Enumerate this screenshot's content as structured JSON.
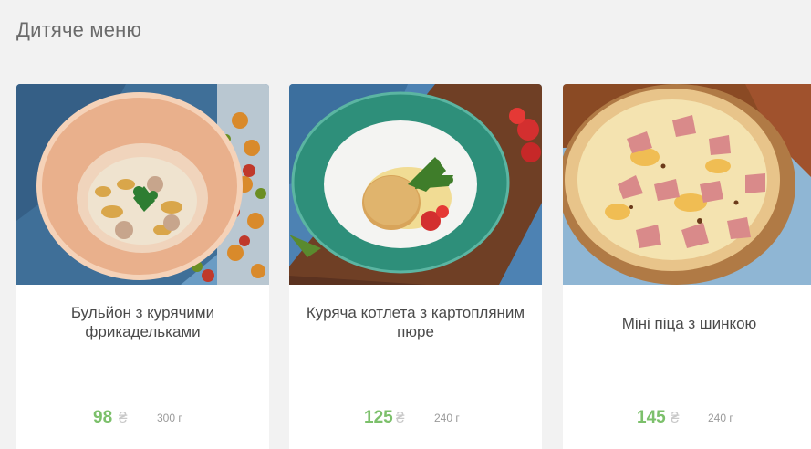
{
  "section": {
    "title": "Дитяче меню"
  },
  "items": [
    {
      "name": "Бульйон з курячими фрикадельками",
      "price": "98",
      "currency": "₴",
      "weight": "300 г"
    },
    {
      "name": "Куряча котлета з картопляним пюре",
      "price": "125",
      "currency": "₴",
      "weight": "240 г"
    },
    {
      "name": "Міні піца з шинкою",
      "price": "145",
      "currency": "₴",
      "weight": "240 г"
    }
  ],
  "colors": {
    "price": "#7cc06b",
    "background": "#f2f2f2",
    "card": "#ffffff"
  }
}
